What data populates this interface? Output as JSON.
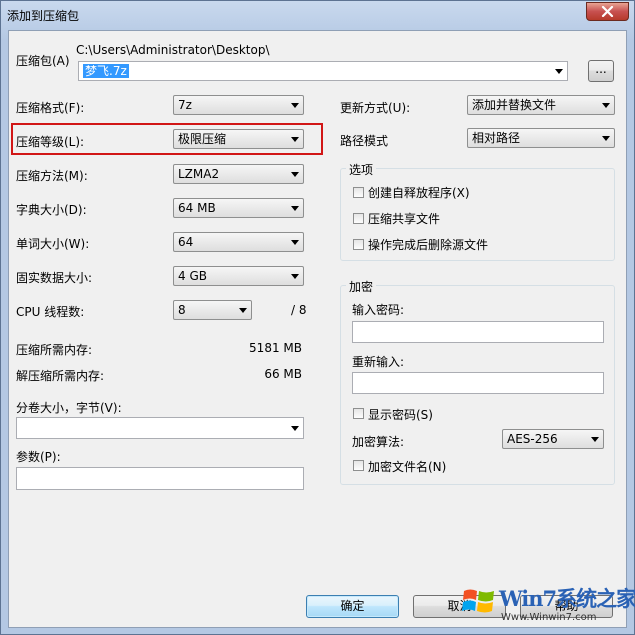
{
  "window": {
    "title": "添加到压缩包"
  },
  "archive": {
    "label": "压缩包(A)",
    "path": "C:\\Users\\Administrator\\Desktop\\",
    "filename": "梦飞.7z",
    "browse_label": "..."
  },
  "left": {
    "format": {
      "label": "压缩格式(F):",
      "value": "7z"
    },
    "level": {
      "label": "压缩等级(L):",
      "value": "极限压缩"
    },
    "method": {
      "label": "压缩方法(M):",
      "value": "LZMA2"
    },
    "dict": {
      "label": "字典大小(D):",
      "value": "64 MB"
    },
    "word": {
      "label": "单词大小(W):",
      "value": "64"
    },
    "solid": {
      "label": "固实数据大小:",
      "value": "4 GB"
    },
    "threads": {
      "label": "CPU 线程数:",
      "value": "8",
      "max": "/ 8"
    },
    "mem_compress": {
      "label": "压缩所需内存:",
      "value": "5181 MB"
    },
    "mem_decompress": {
      "label": "解压缩所需内存:",
      "value": "66 MB"
    },
    "volume": {
      "label": "分卷大小，字节(V):",
      "value": ""
    },
    "params": {
      "label": "参数(P):",
      "value": ""
    }
  },
  "right": {
    "update": {
      "label": "更新方式(U):",
      "value": "添加并替换文件"
    },
    "pathmode": {
      "label": "路径模式",
      "value": "相对路径"
    },
    "options": {
      "title": "选项",
      "sfx": "创建自释放程序(X)",
      "shared": "压缩共享文件",
      "delete": "操作完成后删除源文件"
    },
    "encryption": {
      "title": "加密",
      "password_label": "输入密码:",
      "reenter_label": "重新输入:",
      "show_password": "显示密码(S)",
      "method_label": "加密算法:",
      "method_value": "AES-256",
      "encrypt_names": "加密文件名(N)"
    }
  },
  "buttons": {
    "ok": "确定",
    "cancel": "取消",
    "help": "帮助"
  },
  "watermark": {
    "brand": "Win7系统之家",
    "url": "Www.Winwin7.com"
  },
  "colors": {
    "highlight": "#d11616",
    "selection": "#3399ff"
  }
}
